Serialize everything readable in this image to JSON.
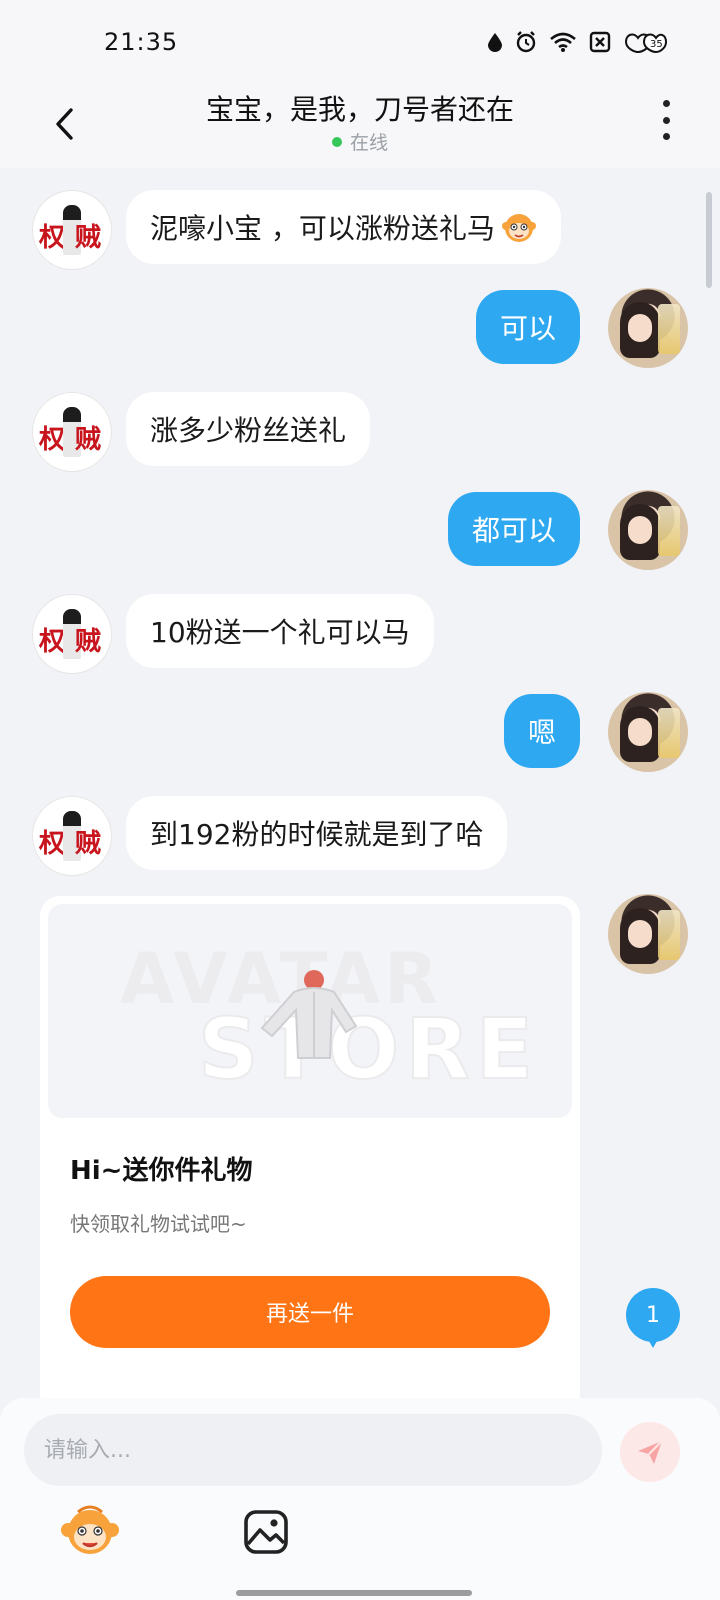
{
  "status_bar": {
    "time": "21:35",
    "icons": [
      "droplet-icon",
      "alarm-icon",
      "wifi-icon",
      "sim-off-icon",
      "battery-icon"
    ],
    "battery_text": "35"
  },
  "header": {
    "title": "宝宝，是我，刀号者还在",
    "status": "在线",
    "status_color": "#35c759"
  },
  "messages": [
    {
      "side": "other",
      "text": "泥嚎小宝 ，可以涨粉送礼马"
    },
    {
      "side": "self",
      "text": "可以"
    },
    {
      "side": "other",
      "text": "涨多少粉丝送礼"
    },
    {
      "side": "self",
      "text": "都可以"
    },
    {
      "side": "other",
      "text": "10粉送一个礼可以马"
    },
    {
      "side": "self",
      "text": "嗯"
    },
    {
      "side": "other",
      "text": "到192粉的时候就是到了哈"
    }
  ],
  "other_avatar_text": {
    "left": "权",
    "right": "贼"
  },
  "gift_card": {
    "watermark_line1": "AVATAR",
    "watermark_line2": "STORE",
    "title": "Hi~送你件礼物",
    "subtitle": "快领取礼物试试吧~",
    "button_label": "再送一件"
  },
  "new_message_badge": "1",
  "input": {
    "placeholder": "请输入..."
  },
  "colors": {
    "self_bubble": "#2fa8f2",
    "gift_button": "#ff7414",
    "background": "#f2f3f7"
  }
}
